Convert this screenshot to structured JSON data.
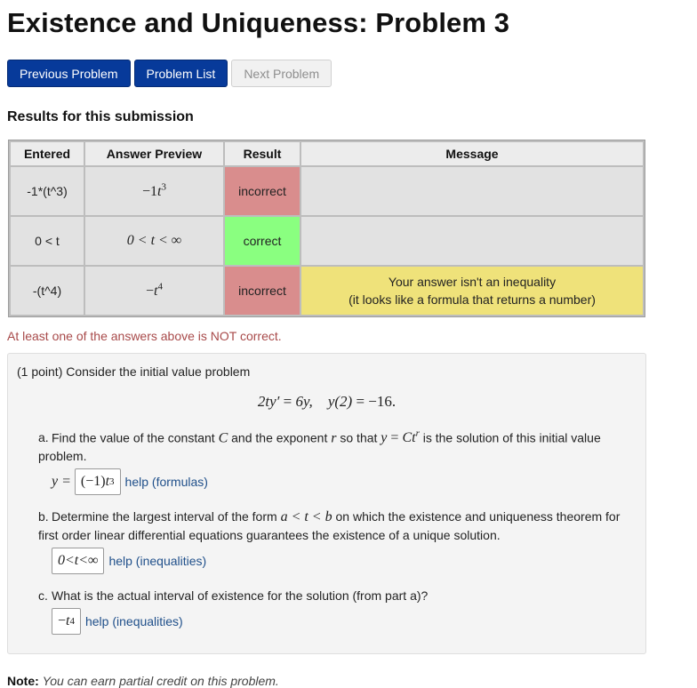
{
  "page": {
    "title": "Existence and Uniqueness: Problem 3"
  },
  "nav": {
    "previous": "Previous Problem",
    "list": "Problem List",
    "next": "Next Problem"
  },
  "results": {
    "title": "Results for this submission",
    "headers": [
      "Entered",
      "Answer Preview",
      "Result",
      "Message"
    ],
    "rows": [
      {
        "entered": "-1*(t^3)",
        "preview": {
          "lead": "−1",
          "var": "t",
          "exp": "3"
        },
        "result": "incorrect",
        "message1": "",
        "message2": ""
      },
      {
        "entered": "0 < t",
        "preview": {
          "text": "0 < t < ∞"
        },
        "result": "correct",
        "message1": "",
        "message2": ""
      },
      {
        "entered": "-(t^4)",
        "preview": {
          "lead": "−",
          "var": "t",
          "exp": "4"
        },
        "result": "incorrect",
        "message1": "Your answer isn't an inequality",
        "message2": "(it looks like a formula that returns a number)"
      }
    ],
    "summary": "At least one of the answers above is NOT correct."
  },
  "colors": {
    "incorrect": "#d98d8d",
    "correct": "#8aff80",
    "warning": "#efe27a",
    "primary_button": "#073a9a",
    "summary_text": "#a84a4a",
    "help_link": "#1f4f8a"
  },
  "problem": {
    "intro": "(1 point) Consider the initial value problem",
    "equation": {
      "lhs": "2ty′",
      "rhs1": "6y,",
      "ic": "y(2)",
      "rhs2": "−16."
    },
    "part_a": {
      "label": "a.",
      "text_pre": "Find the value of the constant ",
      "c": "C",
      "text_mid": " and the exponent ",
      "r": "r",
      "text_post": " so that ",
      "formula_y": "y",
      "formula_c": "Ct",
      "formula_r": "r",
      "text_end": " is the solution of this initial value problem.",
      "answer_label": "y =",
      "answer": {
        "lead": "(−1)",
        "var": "t",
        "exp": "3"
      },
      "help": "help (formulas)"
    },
    "part_b": {
      "label": "b.",
      "text_pre": "Determine the largest interval of the form ",
      "interval": "a < t < b",
      "text_post": " on which the existence and uniqueness theorem for first order linear differential equations guarantees the existence of a unique solution.",
      "answer": "0<t<∞",
      "help": "help (inequalities)"
    },
    "part_c": {
      "label": "c.",
      "text": "What is the actual interval of existence for the solution (from part a)?",
      "answer": {
        "lead": "−",
        "var": "t",
        "exp": "4"
      },
      "help": "help (inequalities)"
    }
  },
  "note": {
    "label": "Note:",
    "text": "You can earn partial credit on this problem."
  }
}
